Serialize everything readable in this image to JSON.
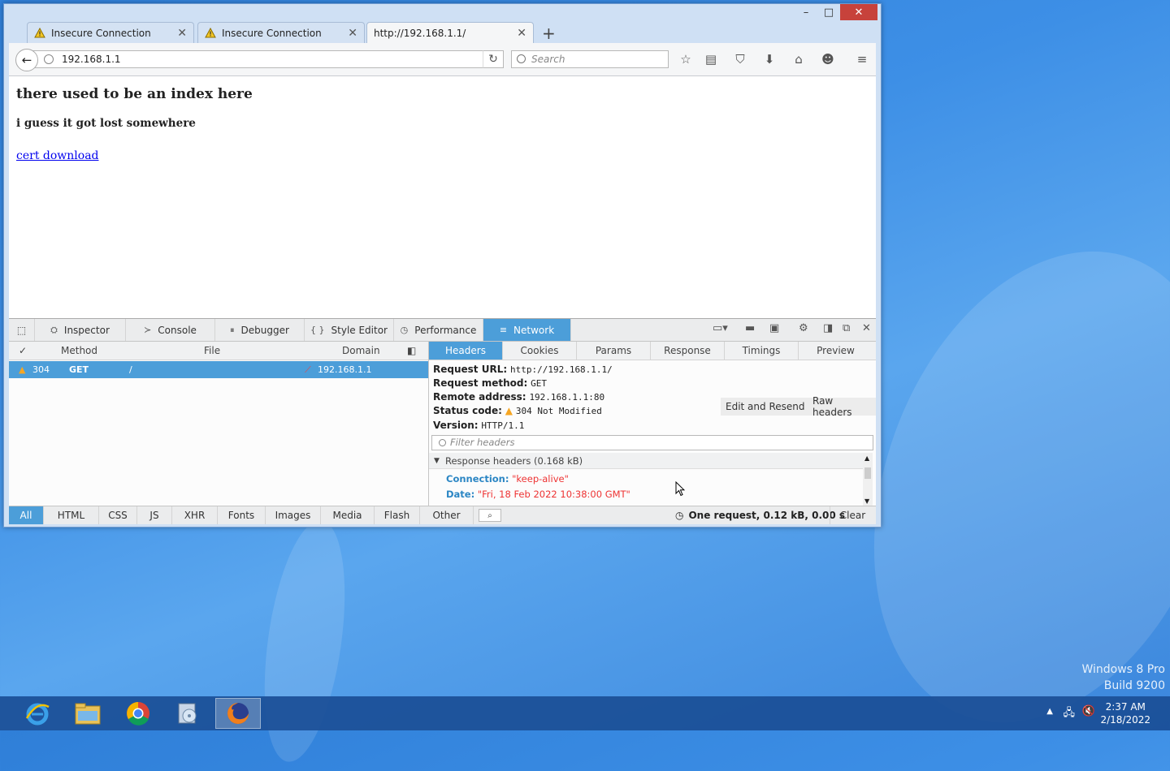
{
  "desktop": {
    "watermark_line1": "Windows 8 Pro",
    "watermark_line2": "Build 9200"
  },
  "window": {
    "minimize": "–",
    "maximize": "□",
    "close": "✕"
  },
  "tabs": [
    {
      "label": "Insecure Connection",
      "close": "✕"
    },
    {
      "label": "Insecure Connection",
      "close": "✕"
    },
    {
      "label": "http://192.168.1.1/",
      "close": "✕"
    }
  ],
  "newtab": "+",
  "nav": {
    "url": "192.168.1.1",
    "search_placeholder": "Search"
  },
  "page": {
    "heading": "there used to be an index here",
    "subheading": "i guess it got lost somewhere",
    "link": "cert download"
  },
  "devtools": {
    "tabs": [
      "Inspector",
      "Console",
      "Debugger",
      "Style Editor",
      "Performance",
      "Network"
    ],
    "tab_icons": [
      "⛭",
      "≻",
      "⏸",
      "{ }",
      "◷",
      "≡"
    ],
    "columns": {
      "check": "✓",
      "method": "Method",
      "file": "File",
      "domain": "Domain"
    },
    "request": {
      "status": "304",
      "method": "GET",
      "file": "/",
      "domain": "192.168.1.1"
    },
    "detail_tabs": [
      "Headers",
      "Cookies",
      "Params",
      "Response",
      "Timings",
      "Preview"
    ],
    "headers": {
      "url_label": "Request URL:",
      "url": "http://192.168.1.1/",
      "method_label": "Request method:",
      "method": "GET",
      "remote_label": "Remote address:",
      "remote": "192.168.1.1:80",
      "status_label": "Status code:",
      "status": "304 Not Modified",
      "version_label": "Version:",
      "version": "HTTP/1.1",
      "edit_resend": "Edit and Resend",
      "raw_headers": "Raw headers",
      "filter_placeholder": "Filter headers",
      "response_headers": "Response headers (0.168 kB)",
      "items": [
        {
          "key": "Connection:",
          "value": "\"keep-alive\""
        },
        {
          "key": "Date:",
          "value": "\"Fri, 18 Feb 2022 10:38:00 GMT\""
        }
      ]
    },
    "footer": {
      "filters": [
        "All",
        "HTML",
        "CSS",
        "JS",
        "XHR",
        "Fonts",
        "Images",
        "Media",
        "Flash",
        "Other"
      ],
      "summary": "One request, 0.12 kB, 0.00 s",
      "clear": "Clear"
    }
  },
  "taskbar": {
    "time": "2:37 AM",
    "date": "2/18/2022"
  }
}
